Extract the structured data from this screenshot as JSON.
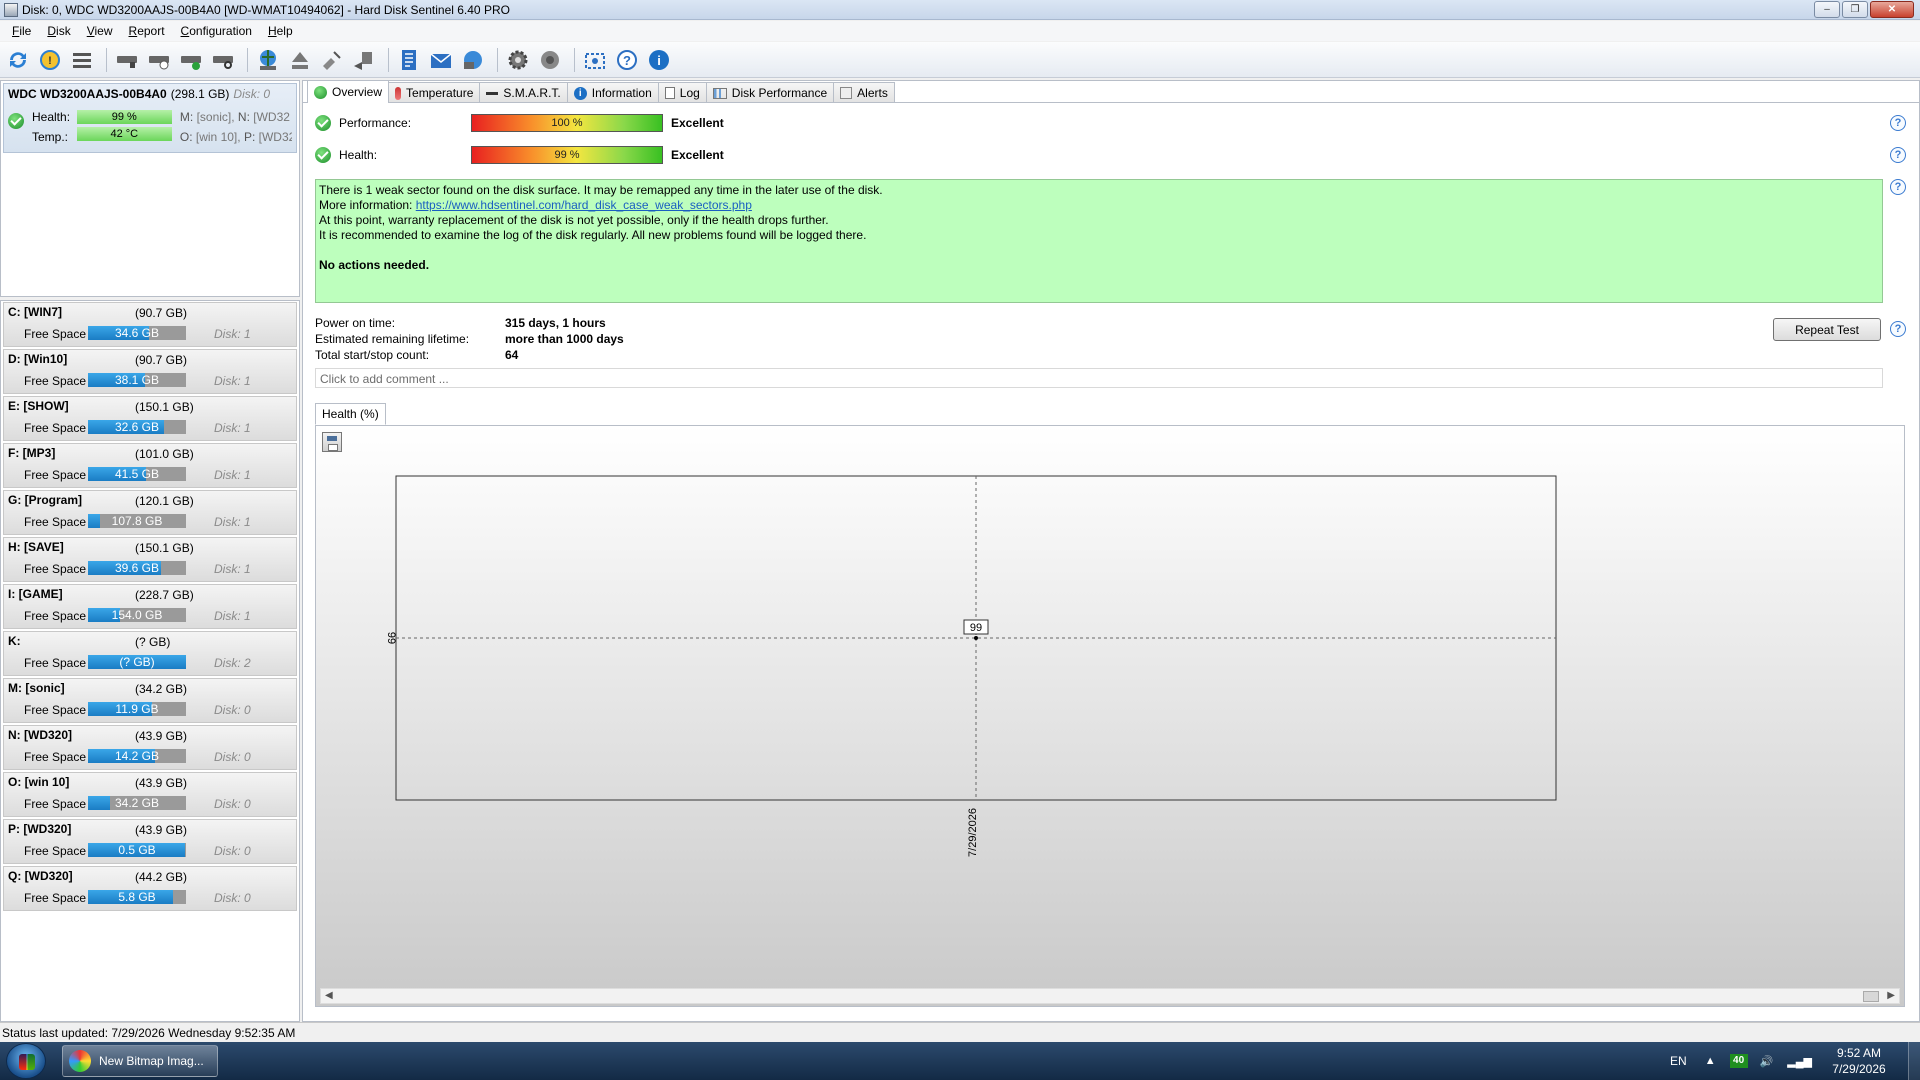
{
  "window": {
    "title": "Disk: 0, WDC WD3200AAJS-00B4A0 [WD-WMAT10494062]  -  Hard Disk Sentinel 6.40 PRO"
  },
  "menu": {
    "items": [
      {
        "label": "File",
        "accel": "F",
        "rest": "ile"
      },
      {
        "label": "Disk",
        "accel": "D",
        "rest": "isk"
      },
      {
        "label": "View",
        "accel": "V",
        "rest": "iew"
      },
      {
        "label": "Report",
        "accel": "R",
        "rest": "eport"
      },
      {
        "label": "Configuration",
        "accel": "C",
        "rest": "onfiguration"
      },
      {
        "label": "Help",
        "accel": "H",
        "rest": "elp"
      }
    ]
  },
  "toolbar": {
    "icons": [
      "refresh-icon",
      "refresh-alert-icon",
      "hdd-list-icon",
      "disk-test-icon",
      "disk-schedule-icon",
      "disk-check-icon",
      "disk-search-icon",
      "globe-icon",
      "eject-icon",
      "satellite-icon",
      "transfer-icon",
      "report-icon",
      "email-icon",
      "network-icon",
      "settings-icon",
      "sound-icon",
      "screenshot-icon",
      "help-icon",
      "about-icon"
    ]
  },
  "disk": {
    "model": "WDC WD3200AAJS-00B4A0",
    "size": "(298.1 GB)",
    "disk_num": "Disk: 0",
    "health_label": "Health:",
    "health_value": "99 %",
    "temp_label": "Temp.:",
    "temp_value": "42 °C",
    "parts_line1_a": "M:",
    "parts_line1_b": "[sonic],",
    "parts_line1_c": "N:",
    "parts_line1_d": "[WD32",
    "parts_line2_a": "O:",
    "parts_line2_b": "[win 10],",
    "parts_line2_c": "P:",
    "parts_line2_d": "[WD32"
  },
  "partitions": [
    {
      "name": "C: [WIN7]",
      "size": "(90.7 GB)",
      "free_label": "Free Space",
      "free": "34.6 GB",
      "free_ratio": 0.38,
      "disk": "Disk: 1"
    },
    {
      "name": "D: [Win10]",
      "size": "(90.7 GB)",
      "free_label": "Free Space",
      "free": "38.1 GB",
      "free_ratio": 0.42,
      "disk": "Disk: 1"
    },
    {
      "name": "E: [SHOW]",
      "size": "(150.1 GB)",
      "free_label": "Free Space",
      "free": "32.6 GB",
      "free_ratio": 0.22,
      "disk": "Disk: 1"
    },
    {
      "name": "F: [MP3]",
      "size": "(101.0 GB)",
      "free_label": "Free Space",
      "free": "41.5 GB",
      "free_ratio": 0.41,
      "disk": "Disk: 1"
    },
    {
      "name": "G: [Program]",
      "size": "(120.1 GB)",
      "free_label": "Free Space",
      "free": "107.8 GB",
      "free_ratio": 0.9,
      "disk": "Disk: 1"
    },
    {
      "name": "H: [SAVE]",
      "size": "(150.1 GB)",
      "free_label": "Free Space",
      "free": "39.6 GB",
      "free_ratio": 0.26,
      "disk": "Disk: 1"
    },
    {
      "name": "I: [GAME]",
      "size": "(228.7 GB)",
      "free_label": "Free Space",
      "free": "154.0 GB",
      "free_ratio": 0.67,
      "disk": "Disk: 1"
    },
    {
      "name": "K:",
      "size": "(? GB)",
      "free_label": "Free Space",
      "free": "(? GB)",
      "free_ratio": 0.0,
      "disk": "Disk: 2"
    },
    {
      "name": "M: [sonic]",
      "size": "(34.2 GB)",
      "free_label": "Free Space",
      "free": "11.9 GB",
      "free_ratio": 0.35,
      "disk": "Disk: 0"
    },
    {
      "name": "N: [WD320]",
      "size": "(43.9 GB)",
      "free_label": "Free Space",
      "free": "14.2 GB",
      "free_ratio": 0.32,
      "disk": "Disk: 0"
    },
    {
      "name": "O: [win 10]",
      "size": "(43.9 GB)",
      "free_label": "Free Space",
      "free": "34.2 GB",
      "free_ratio": 0.78,
      "disk": "Disk: 0"
    },
    {
      "name": "P: [WD320]",
      "size": "(43.9 GB)",
      "free_label": "Free Space",
      "free": "0.5 GB",
      "free_ratio": 0.01,
      "disk": "Disk: 0"
    },
    {
      "name": "Q: [WD320]",
      "size": "(44.2 GB)",
      "free_label": "Free Space",
      "free": "5.8 GB",
      "free_ratio": 0.13,
      "disk": "Disk: 0"
    }
  ],
  "tabs": [
    {
      "label": "Overview",
      "icon": "green-check-icon",
      "active": true
    },
    {
      "label": "Temperature",
      "icon": "thermometer-icon",
      "active": false
    },
    {
      "label": "S.M.A.R.T.",
      "icon": "smart-icon",
      "active": false
    },
    {
      "label": "Information",
      "icon": "info-icon",
      "active": false
    },
    {
      "label": "Log",
      "icon": "log-icon",
      "active": false
    },
    {
      "label": "Disk Performance",
      "icon": "performance-icon",
      "active": false
    },
    {
      "label": "Alerts",
      "icon": "alerts-icon",
      "active": false
    }
  ],
  "overview": {
    "performance_label": "Performance:",
    "performance_value": "100 %",
    "performance_rating": "Excellent",
    "health_label": "Health:",
    "health_value": "99 %",
    "health_rating": "Excellent",
    "msg_line1": "There is 1 weak sector found on the disk surface. It may be remapped any time in the later use of the disk.",
    "msg_more_label": "More information:",
    "msg_link": "https://www.hdsentinel.com/hard_disk_case_weak_sectors.php",
    "msg_line3": "At this point, warranty replacement of the disk is not yet possible, only if the health drops further.",
    "msg_line4": "It is recommended to examine the log of the disk regularly. All new problems found will be logged there.",
    "msg_actions": "No actions needed.",
    "power_on_label": "Power on time:",
    "power_on_value": "315 days, 1 hours",
    "lifetime_label": "Estimated remaining lifetime:",
    "lifetime_value": "more than 1000 days",
    "startstop_label": "Total start/stop count:",
    "startstop_value": "64",
    "repeat_test": "Repeat Test",
    "comment_placeholder": "Click to add comment ...",
    "chart_tab": "Health (%)",
    "help_glyph": "?"
  },
  "chart_data": {
    "type": "line",
    "title": "Health (%)",
    "x": [
      "7/29/2026"
    ],
    "series": [
      {
        "values": [
          99
        ]
      }
    ],
    "ytick": "99",
    "point_label": "99",
    "grid": true
  },
  "status": {
    "text": "Status last updated: 7/29/2026 Wednesday 9:52:35 AM"
  },
  "taskbar": {
    "task_label": "New Bitmap Imag...",
    "lang": "EN",
    "battery": "40",
    "time": "9:52 AM",
    "date": "7/29/2026"
  }
}
